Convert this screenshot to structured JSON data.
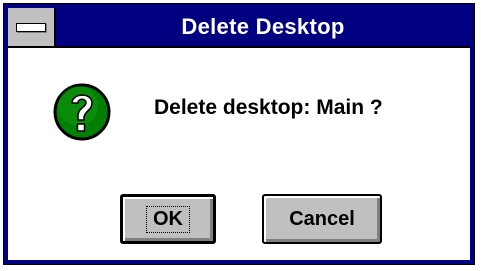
{
  "dialog": {
    "title": "Delete Desktop",
    "message": "Delete desktop: Main ?",
    "icon": "question-icon",
    "buttons": {
      "ok_label": "OK",
      "cancel_label": "Cancel"
    }
  },
  "colors": {
    "titlebar": "#000080",
    "title_text": "#ffffff",
    "button_face": "#c0c0c0",
    "icon_fill": "#008000"
  }
}
